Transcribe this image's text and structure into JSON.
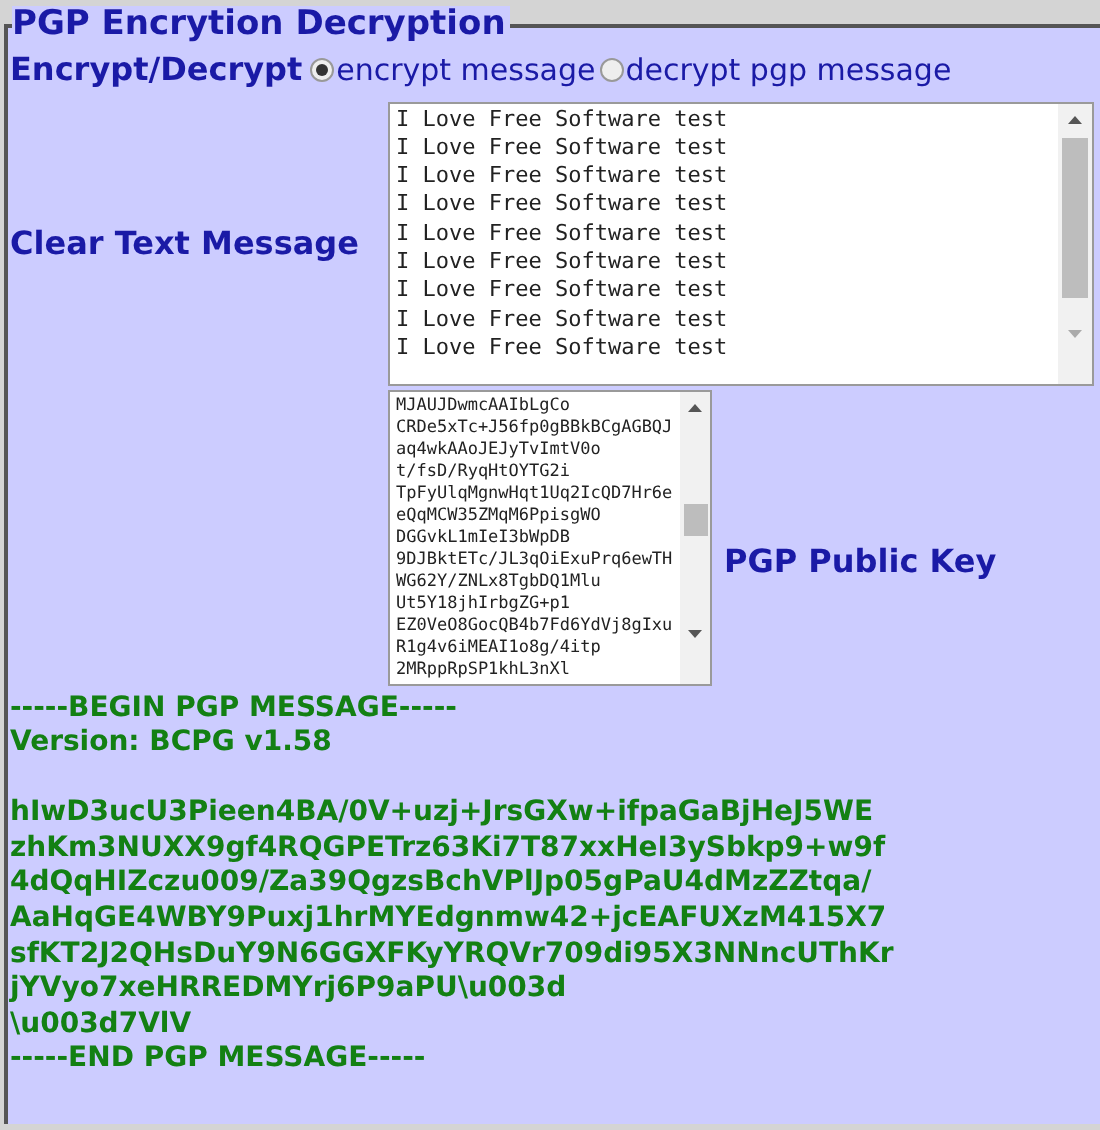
{
  "legend": "PGP Encrytion Decryption",
  "mode": {
    "label": "Encrypt/Decrypt",
    "options": [
      {
        "label": "encrypt message",
        "selected": true
      },
      {
        "label": "decrypt pgp message",
        "selected": false
      }
    ]
  },
  "clear_text": {
    "label": "Clear Text Message",
    "lines": [
      "I Love Free Software test",
      "I Love Free Software test",
      "I Love Free Software test",
      "I Love Free Software test",
      "I Love Free Software test",
      "I Love Free Software test",
      "I Love Free Software test",
      "I Love Free Software test",
      "I Love Free Software test"
    ]
  },
  "public_key": {
    "label": "PGP Public Key",
    "lines": [
      "MJAUJDwmcAAIbLgCo",
      "CRDe5xTc+J56fp0gBBkBCgAGBQJaq4wkAAoJEJyTvImtV0o",
      "t/fsD/RyqHtOYTG2i",
      "TpFyUlqMgnwHqt1Uq2IcQD7Hr6eeQqMCW35ZMqM6PpisgWO",
      "DGGvkL1mIeI3bWpDB",
      "9DJBktETc/JL3qOiExuPrq6ewTHWG62Y/ZNLx8TgbDQ1Mlu",
      "Ut5Y18jhIrbgZG+p1",
      "EZ0VeO8GocQB4b7Fd6YdVj8gIxuR1g4v6iMEAI1o8g/4itp",
      "2MRppRpSP1khL3nXl"
    ]
  },
  "output": {
    "header": [
      "-----BEGIN PGP MESSAGE-----",
      "Version: BCPG v1.58"
    ],
    "body": [
      "hIwD3ucU3Pieen4BA/0V+uzj+JrsGXw+ifpaGaBjHeJ5WE",
      "zhKm3NUXX9gf4RQGPETrz63Ki7T87xxHeI3ySbkp9+w9f",
      "4dQqHIZczu009/Za39QgzsBchVPlJp05gPaU4dMzZZtqa/",
      "AaHqGE4WBY9Puxj1hrMYEdgnmw42+jcEAFUXzM415X7",
      "sfKT2J2QHsDuY9N6GGXFKyYRQVr709di95X3NNncUThKr",
      "jYVyo7xeHRREDMYrj6P9aPU\\u003d",
      "\\u003d7VlV",
      "-----END PGP MESSAGE-----"
    ]
  }
}
